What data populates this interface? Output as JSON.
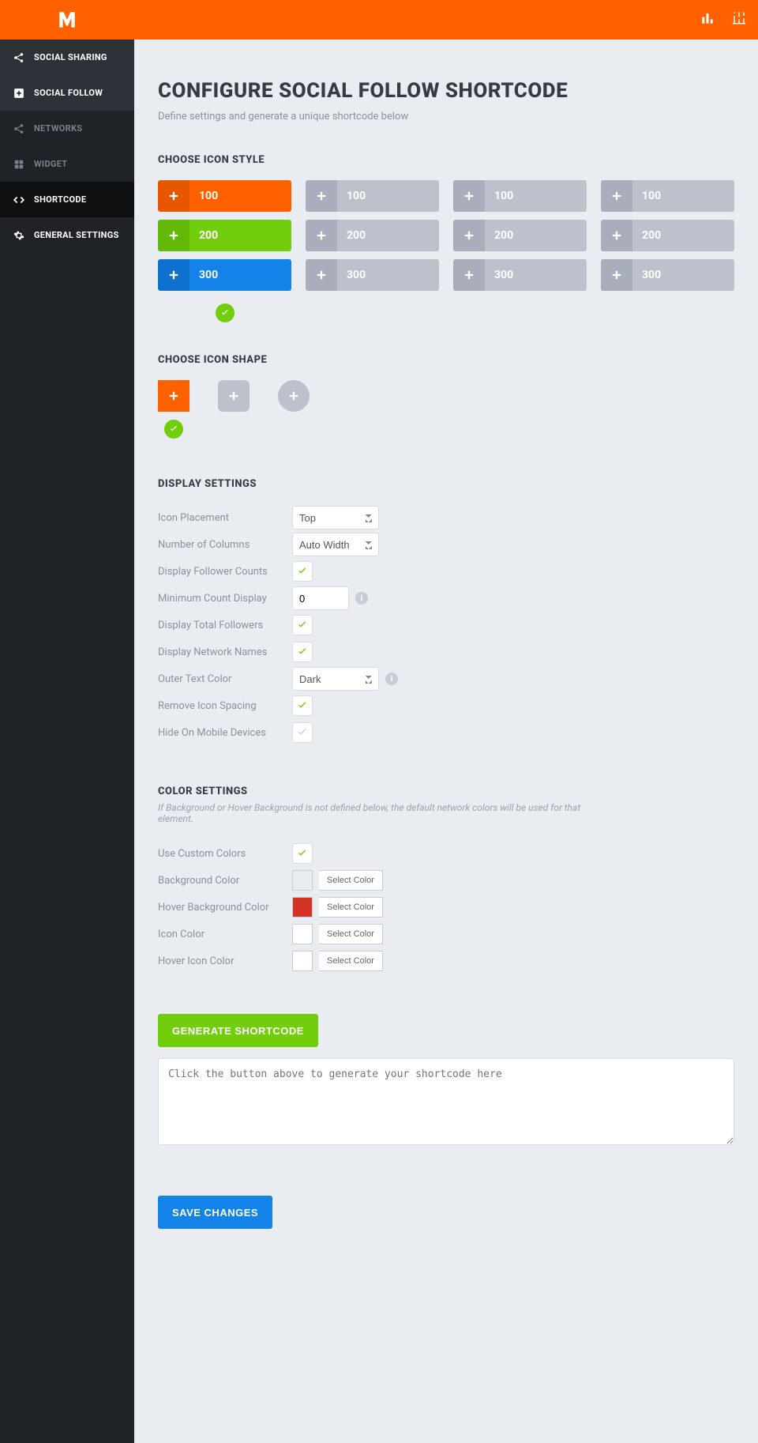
{
  "header": {
    "icons": [
      "bar-chart-icon",
      "sliders-icon"
    ]
  },
  "sidebar": {
    "items": [
      {
        "label": "SOCIAL SHARING",
        "icon": "share-icon",
        "type": "top"
      },
      {
        "label": "SOCIAL FOLLOW",
        "icon": "plus-box-icon",
        "type": "top-active"
      },
      {
        "label": "NETWORKS",
        "icon": "share-icon",
        "type": "sub"
      },
      {
        "label": "WIDGET",
        "icon": "grid-icon",
        "type": "sub"
      },
      {
        "label": "SHORTCODE",
        "icon": "code-icon",
        "type": "sub-active"
      },
      {
        "label": "GENERAL SETTINGS",
        "icon": "gear-icon",
        "type": "sub"
      }
    ]
  },
  "page": {
    "title": "CONFIGURE SOCIAL FOLLOW SHORTCODE",
    "subtitle": "Define settings and generate a unique shortcode below"
  },
  "icon_style": {
    "heading": "CHOOSE ICON STYLE",
    "columns": 4,
    "rows": [
      {
        "color": "orange",
        "label": "100"
      },
      {
        "color": "green",
        "label": "200"
      },
      {
        "color": "blue",
        "label": "300"
      }
    ],
    "gray_labels": [
      "100",
      "200",
      "300",
      "100",
      "200",
      "300",
      "100",
      "200",
      "300"
    ],
    "selected_column": 0
  },
  "icon_shape": {
    "heading": "CHOOSE ICON SHAPE",
    "shapes": [
      "square",
      "rounded",
      "circle"
    ],
    "selected": 0
  },
  "display_settings": {
    "heading": "DISPLAY SETTINGS",
    "rows": {
      "icon_placement": {
        "label": "Icon Placement",
        "value": "Top"
      },
      "num_columns": {
        "label": "Number of Columns",
        "value": "Auto Width"
      },
      "display_follower_counts": {
        "label": "Display Follower Counts",
        "checked": true
      },
      "min_count": {
        "label": "Minimum Count Display",
        "value": "0"
      },
      "display_total": {
        "label": "Display Total Followers",
        "checked": true
      },
      "display_names": {
        "label": "Display Network Names",
        "checked": true
      },
      "outer_text_color": {
        "label": "Outer Text Color",
        "value": "Dark"
      },
      "remove_spacing": {
        "label": "Remove Icon Spacing",
        "checked": true
      },
      "hide_mobile": {
        "label": "Hide On Mobile Devices",
        "checked": false
      }
    }
  },
  "color_settings": {
    "heading": "COLOR SETTINGS",
    "note": "If Background or Hover Background is not defined below, the default network colors will be used for that element.",
    "select_label": "Select Color",
    "rows": {
      "use_custom": {
        "label": "Use Custom Colors",
        "checked": true
      },
      "bg": {
        "label": "Background Color",
        "swatch": "#7a00c9"
      },
      "hover_bg": {
        "label": "Hover Background Color",
        "swatch": "#d53224"
      },
      "icon_color": {
        "label": "Icon Color",
        "swatch": "#ffffff"
      },
      "hover_icon_color": {
        "label": "Hover Icon Color",
        "swatch": "#ffffff"
      }
    }
  },
  "generate": {
    "button": "GENERATE SHORTCODE",
    "placeholder": "Click the button above to generate your shortcode here"
  },
  "save": {
    "button": "SAVE CHANGES"
  }
}
